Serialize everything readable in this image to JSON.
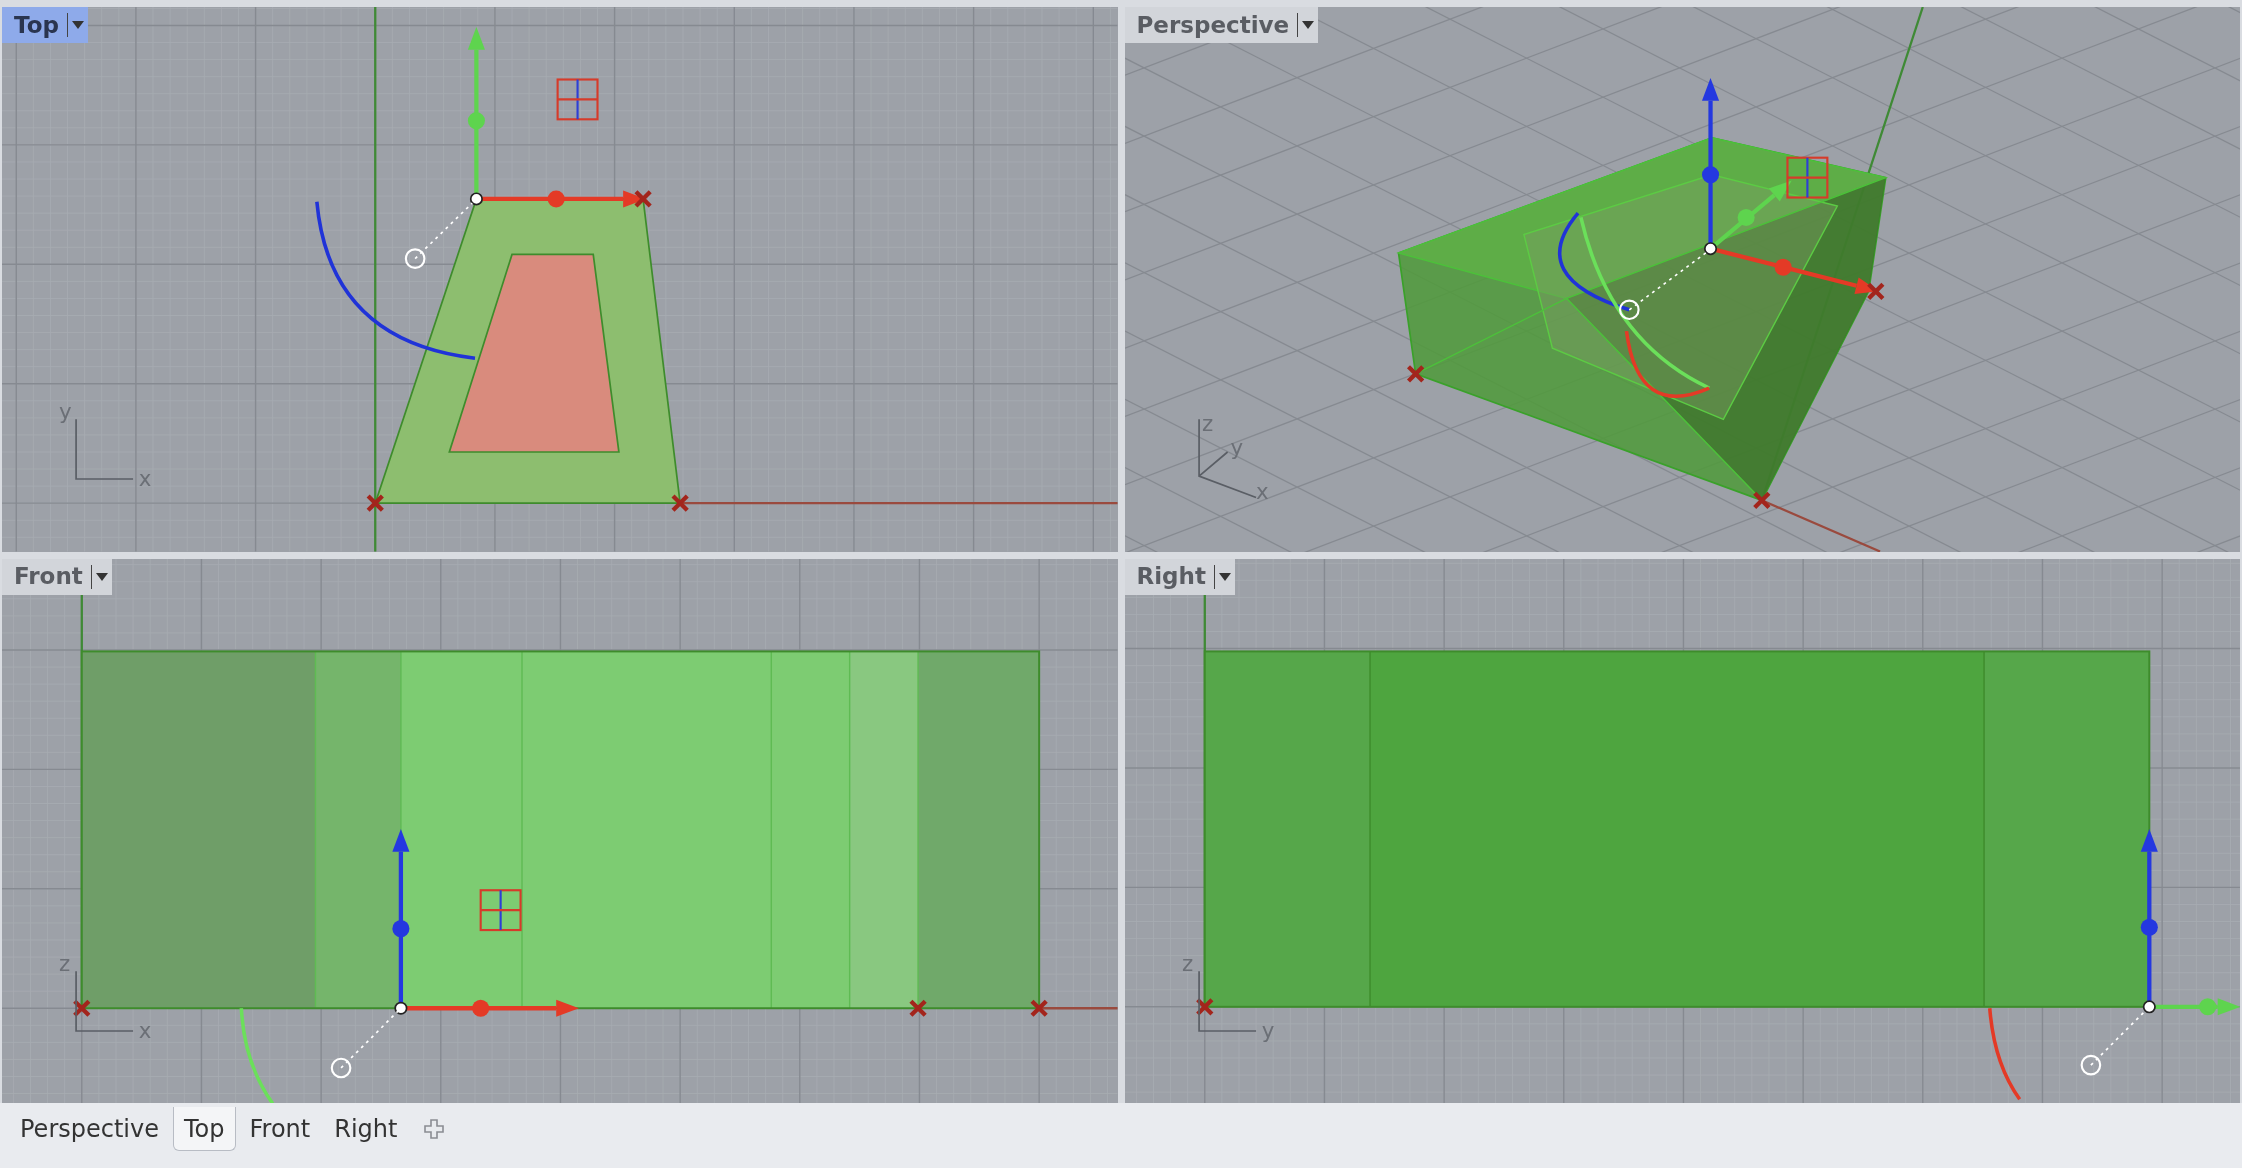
{
  "viewports": [
    {
      "title": "Top",
      "selected": true,
      "kind": "top",
      "axis_labels": [
        "y",
        "x"
      ]
    },
    {
      "title": "Perspective",
      "selected": false,
      "kind": "perspective",
      "axis_labels": [
        "z",
        "y",
        "x"
      ]
    },
    {
      "title": "Front",
      "selected": false,
      "kind": "front",
      "axis_labels": [
        "z",
        "x"
      ]
    },
    {
      "title": "Right",
      "selected": false,
      "kind": "right",
      "axis_labels": [
        "z",
        "y"
      ]
    }
  ],
  "tabs": [
    {
      "label": "Perspective",
      "selected": false
    },
    {
      "label": "Top",
      "selected": true
    },
    {
      "label": "Front",
      "selected": false
    },
    {
      "label": "Right",
      "selected": false
    }
  ]
}
